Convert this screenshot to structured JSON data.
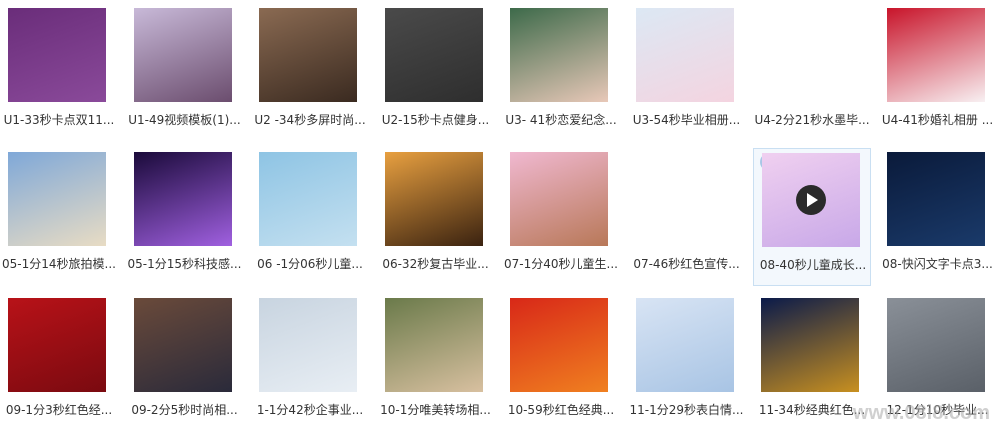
{
  "items": [
    {
      "label": "U1-33秒卡点双11...",
      "colors": [
        "#6a2d7a",
        "#8a4a9a"
      ]
    },
    {
      "label": "U1-49视频模板(1)...",
      "colors": [
        "#c8b9d8",
        "#6b4d6e"
      ]
    },
    {
      "label": "U2 -34秒多屏时尚...",
      "colors": [
        "#8a6a52",
        "#3a2a20"
      ]
    },
    {
      "label": "U2-15秒卡点健身...",
      "colors": [
        "#4a4a4a",
        "#2e2e2e"
      ]
    },
    {
      "label": "U3- 41秒恋爱纪念...",
      "colors": [
        "#3d6a4a",
        "#e8c8b8"
      ]
    },
    {
      "label": "U3-54秒毕业相册...",
      "colors": [
        "#dce8f4",
        "#f4d4e0"
      ]
    },
    {
      "label": "U4-2分21秒水墨毕...",
      "colors": [
        "#ffffff",
        "#ffffff"
      ]
    },
    {
      "label": "U4-41秒婚礼相册 ...",
      "colors": [
        "#c8142a",
        "#f8f0f2"
      ]
    },
    {
      "label": "05-1分14秒旅拍模...",
      "colors": [
        "#7fa8d8",
        "#e8dcc4"
      ]
    },
    {
      "label": "05-1分15秒科技感...",
      "colors": [
        "#1a0a3a",
        "#a060e0"
      ]
    },
    {
      "label": "06 -1分06秒儿童...",
      "colors": [
        "#8ec4e4",
        "#c4e0f0"
      ]
    },
    {
      "label": "06-32秒复古毕业...",
      "colors": [
        "#e8a040",
        "#3a2210"
      ]
    },
    {
      "label": "07-1分40秒儿童生...",
      "colors": [
        "#f0b8d0",
        "#b87858"
      ]
    },
    {
      "label": "07-46秒红色宣传...",
      "colors": [
        "#ffffff",
        "#ffffff"
      ]
    },
    {
      "label": "08-40秒儿童成长...",
      "colors": [
        "#f0d0f0",
        "#c8a8e8"
      ]
    },
    {
      "label": "08-快闪文字卡点3...",
      "colors": [
        "#0a1a3a",
        "#1a3a6a"
      ]
    },
    {
      "label": "09-1分3秒红色经...",
      "colors": [
        "#b81218",
        "#7a0a10"
      ]
    },
    {
      "label": "09-2分5秒时尚相...",
      "colors": [
        "#6a4a3a",
        "#2a2a3a"
      ]
    },
    {
      "label": "1-1分42秒企事业...",
      "colors": [
        "#c8d4e0",
        "#e8eef4"
      ]
    },
    {
      "label": "10-1分唯美转场相...",
      "colors": [
        "#6a7a4a",
        "#d8c0a0"
      ]
    },
    {
      "label": "10-59秒红色经典...",
      "colors": [
        "#d82818",
        "#f08020"
      ]
    },
    {
      "label": "11-1分29秒表白情...",
      "colors": [
        "#d8e4f4",
        "#a8c4e4"
      ]
    },
    {
      "label": "11-34秒经典红色...",
      "colors": [
        "#0a1a4a",
        "#c89020"
      ]
    },
    {
      "label": "12-1分10秒毕业...",
      "colors": [
        "#8a9098",
        "#5a6068"
      ]
    }
  ],
  "selected_index": 14,
  "watermark": "www.08i8.com"
}
